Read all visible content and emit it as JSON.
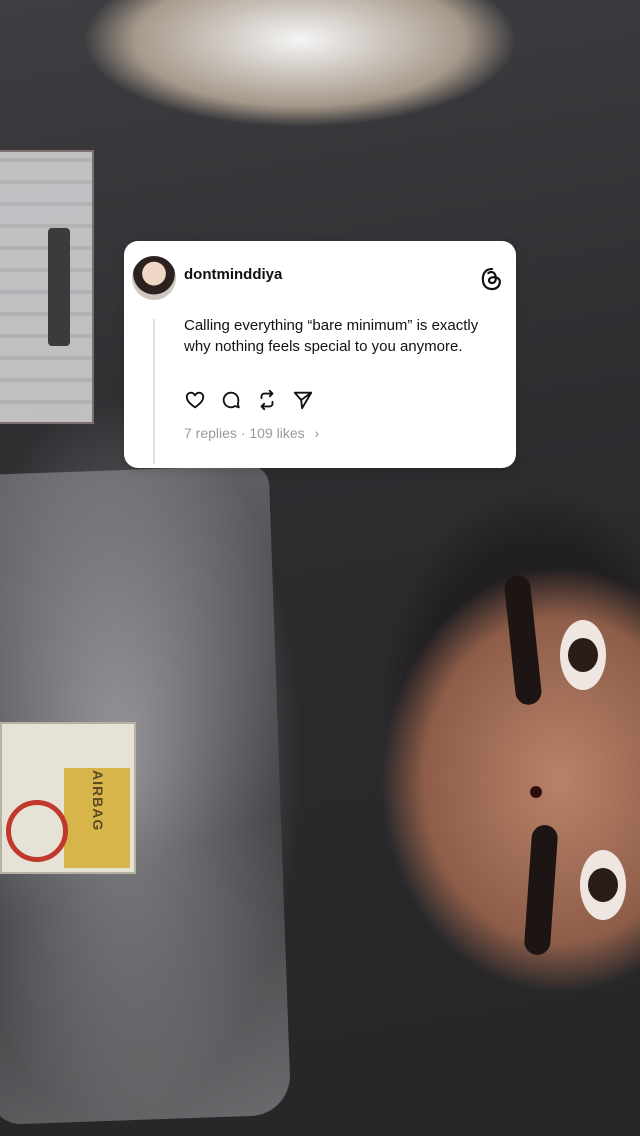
{
  "post": {
    "username": "dontminddiya",
    "text": "Calling everything “bare minimum” is exactly why nothing feels special to you anymore.",
    "replies": "7 replies",
    "separator": "·",
    "likes": "109 likes",
    "chevron": "›",
    "icons": [
      "heart-icon",
      "comment-icon",
      "repost-icon",
      "share-icon",
      "threads-logo-icon"
    ]
  },
  "background": {
    "airbag_label": "AIRBAG"
  }
}
